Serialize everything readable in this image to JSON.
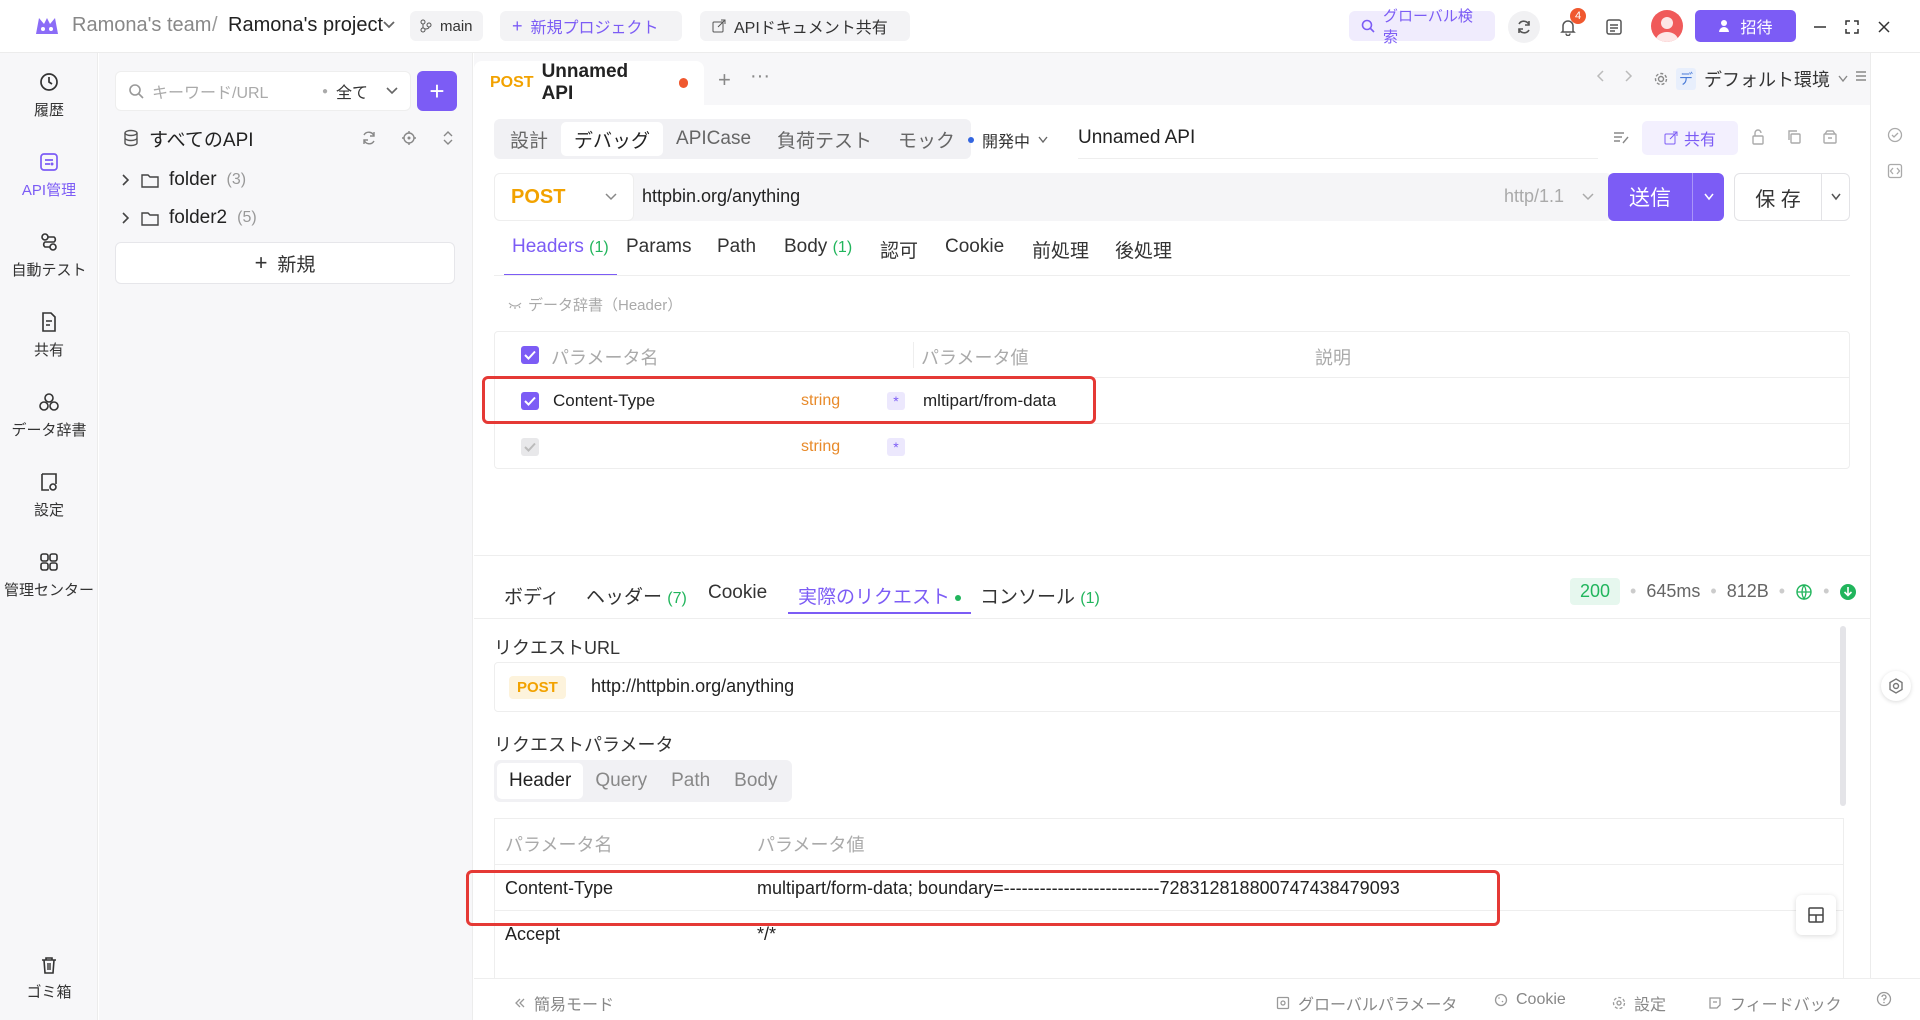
{
  "titlebar": {
    "team": "Ramona's team",
    "separator": "/",
    "project": "Ramona's project",
    "branch": "main",
    "new_project": "新規プロジェクト",
    "share_doc": "APIドキュメント共有",
    "global_search": "グローバル検索",
    "notification_count": "4",
    "invite": "招待"
  },
  "leftnav": [
    {
      "label": "履歴",
      "icon": "history-icon"
    },
    {
      "label": "API管理",
      "icon": "api-management-icon",
      "active": true
    },
    {
      "label": "自動テスト",
      "icon": "auto-test-icon"
    },
    {
      "label": "共有",
      "icon": "share-doc-icon"
    },
    {
      "label": "データ辞書",
      "icon": "data-dictionary-icon"
    },
    {
      "label": "設定",
      "icon": "settings-icon"
    },
    {
      "label": "管理センター",
      "icon": "admin-center-icon"
    }
  ],
  "trash": "ゴミ箱",
  "tree": {
    "search_placeholder": "キーワード/URL",
    "filter": "全て",
    "all_apis": "すべてのAPI",
    "folders": [
      {
        "name": "folder",
        "count": "(3)"
      },
      {
        "name": "folder2",
        "count": "(5)"
      }
    ],
    "new_label": "新規"
  },
  "tabs": {
    "active_method": "POST",
    "active_title": "Unnamed API",
    "env": "デフォルト環境",
    "env_badge": "デ"
  },
  "mode_tabs": [
    "設計",
    "デバッグ",
    "APICase",
    "負荷テスト",
    "モック"
  ],
  "status": "開発中",
  "api_name": "Unnamed API",
  "share_label": "共有",
  "request": {
    "method": "POST",
    "url": "httpbin.org/anything",
    "protocol": "http/1.1",
    "send": "送信",
    "save": "保 存"
  },
  "req_tabs": [
    {
      "label": "Headers",
      "count": "(1)"
    },
    {
      "label": "Params",
      "count": ""
    },
    {
      "label": "Path",
      "count": ""
    },
    {
      "label": "Body",
      "count": "(1)"
    },
    {
      "label": "認可",
      "count": ""
    },
    {
      "label": "Cookie",
      "count": ""
    },
    {
      "label": "前処理",
      "count": ""
    },
    {
      "label": "後処理",
      "count": ""
    }
  ],
  "dict_hint": "データ辞書（Header）",
  "headers_table": {
    "columns": [
      "パラメータ名",
      "パラメータ値",
      "説明"
    ],
    "rows": [
      {
        "name": "Content-Type",
        "type": "string",
        "value": "mltipart/from-data"
      },
      {
        "name": "",
        "type": "string",
        "value": ""
      }
    ]
  },
  "response": {
    "tabs": [
      {
        "label": "ボディ",
        "count": ""
      },
      {
        "label": "ヘッダー",
        "count": "(7)"
      },
      {
        "label": "Cookie",
        "count": ""
      },
      {
        "label": "実際のリクエスト",
        "count": ""
      },
      {
        "label": "コンソール",
        "count": "(1)"
      }
    ],
    "status_code": "200",
    "time": "645ms",
    "size": "812B",
    "request_url_label": "リクエストURL",
    "method": "POST",
    "full_url": "http://httpbin.org/anything",
    "params_label": "リクエストパラメータ",
    "sub_tabs": [
      "Header",
      "Query",
      "Path",
      "Body"
    ],
    "columns": [
      "パラメータ名",
      "パラメータ値"
    ],
    "rows": [
      {
        "name": "Content-Type",
        "value": "multipart/form-data; boundary=--------------------------728312818800747438479093"
      },
      {
        "name": "Accept",
        "value": "*/*"
      }
    ]
  },
  "footer": {
    "simple_mode": "簡易モード",
    "global_params": "グローバルパラメータ",
    "cookie": "Cookie",
    "settings": "設定",
    "feedback": "フィードバック"
  },
  "colors": {
    "accent": "#7c5cf5",
    "post": "#f2a200",
    "highlight": "#e53935",
    "success": "#21b55c"
  }
}
